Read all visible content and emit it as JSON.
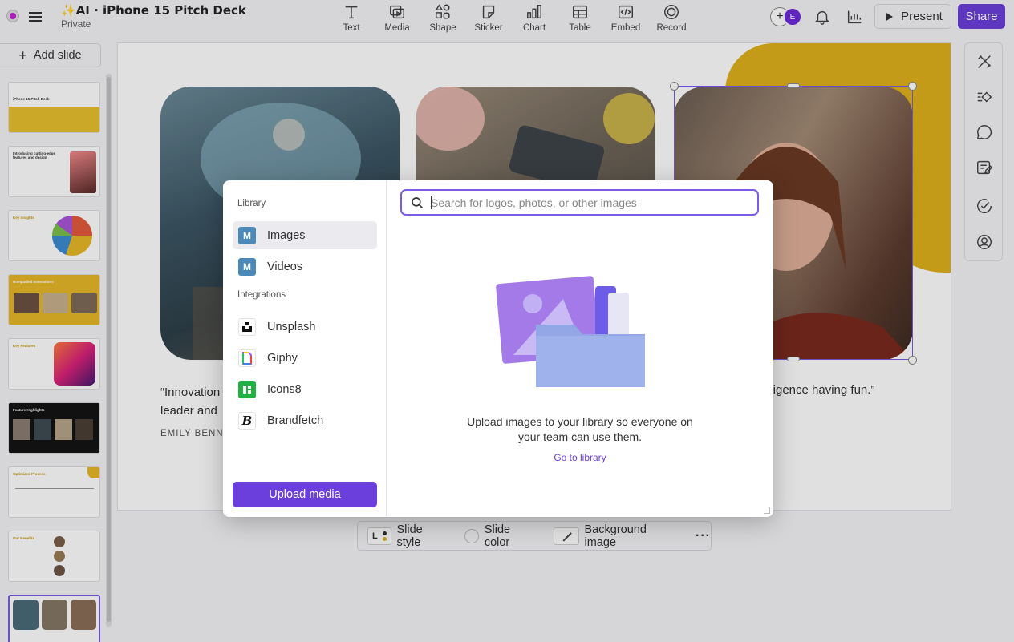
{
  "header": {
    "title": "✨AI · iPhone 15 Pitch Deck",
    "visibility": "Private",
    "tools": [
      {
        "label": "Text",
        "icon": "text-icon"
      },
      {
        "label": "Media",
        "icon": "media-icon"
      },
      {
        "label": "Shape",
        "icon": "shape-icon"
      },
      {
        "label": "Sticker",
        "icon": "sticker-icon"
      },
      {
        "label": "Chart",
        "icon": "chart-icon"
      },
      {
        "label": "Table",
        "icon": "table-icon"
      },
      {
        "label": "Embed",
        "icon": "embed-icon"
      },
      {
        "label": "Record",
        "icon": "record-icon"
      }
    ],
    "collaborator_initial": "E",
    "present_label": "Present",
    "share_label": "Share",
    "accent_color": "#6b3fdb"
  },
  "sidebar": {
    "add_slide_label": "Add slide",
    "slides": [
      {
        "title": "iPhone 15 Pitch Deck"
      },
      {
        "title": "Introducing cutting-edge features and design"
      },
      {
        "title": "Key Insights"
      },
      {
        "title": "Unequalled Innovations"
      },
      {
        "title": "Key Features"
      },
      {
        "title": "Feature Highlights"
      },
      {
        "title": "Optimized Process"
      },
      {
        "title": "Our Benefits"
      },
      {
        "title": ""
      }
    ]
  },
  "canvas": {
    "quote_left_line1": "“Innovation",
    "quote_left_line2": "leader and",
    "author_left": "EMILY BENNE",
    "quote_right": "lligence having fun.”",
    "brand_yellow": "#e0b11c"
  },
  "bottom_bar": {
    "style_letter": "L",
    "slide_style": "Slide style",
    "slide_color": "Slide color",
    "background_image": "Background image",
    "more": "···"
  },
  "modal": {
    "library_heading": "Library",
    "library_items": [
      {
        "label": "Images",
        "badge": "M",
        "active": true
      },
      {
        "label": "Videos",
        "badge": "M",
        "active": false
      }
    ],
    "integrations_heading": "Integrations",
    "integrations": [
      {
        "label": "Unsplash",
        "icon": "unsplash-icon"
      },
      {
        "label": "Giphy",
        "icon": "giphy-icon"
      },
      {
        "label": "Icons8",
        "icon": "icons8-icon"
      },
      {
        "label": "Brandfetch",
        "icon": "brandfetch-icon"
      }
    ],
    "upload_label": "Upload media",
    "search_placeholder": "Search for logos, photos, or other images",
    "search_value": "",
    "empty_line1": "Upload images to your library so everyone on",
    "empty_line2": "your team can use them.",
    "go_to_library": "Go to library"
  }
}
